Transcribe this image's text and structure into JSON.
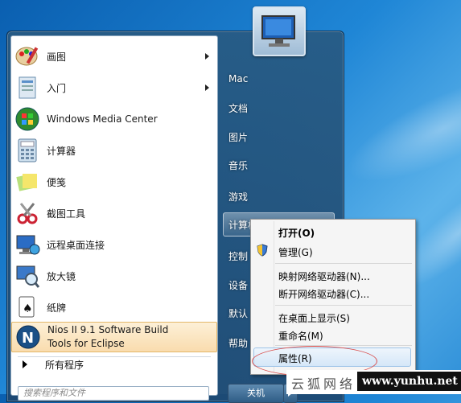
{
  "start_menu": {
    "programs": [
      {
        "label": "画图",
        "icon": "paint-icon",
        "submenu": true
      },
      {
        "label": "入门",
        "icon": "getting-started-icon",
        "submenu": true
      },
      {
        "label": "Windows Media Center",
        "icon": "media-center-icon",
        "submenu": false
      },
      {
        "label": "计算器",
        "icon": "calculator-icon",
        "submenu": false
      },
      {
        "label": "便笺",
        "icon": "sticky-notes-icon",
        "submenu": false
      },
      {
        "label": "截图工具",
        "icon": "snipping-tool-icon",
        "submenu": false
      },
      {
        "label": "远程桌面连接",
        "icon": "remote-desktop-icon",
        "submenu": false
      },
      {
        "label": "放大镜",
        "icon": "magnifier-icon",
        "submenu": false
      },
      {
        "label": "纸牌",
        "icon": "solitaire-icon",
        "submenu": false
      }
    ],
    "highlighted_program": {
      "line1": "Nios II  9.1 Software Build",
      "line2": "Tools for Eclipse",
      "icon": "nios-icon"
    },
    "all_programs": "所有程序",
    "search_placeholder": "搜索程序和文件",
    "right_items": [
      "Mac",
      "文档",
      "图片",
      "音乐",
      "游戏",
      "计算机",
      "控制",
      "设备",
      "默认",
      "帮助"
    ],
    "shutdown_label": "关机"
  },
  "context_menu": {
    "items": [
      "打开(O)",
      "管理(G)",
      "映射网络驱动器(N)...",
      "断开网络驱动器(C)...",
      "在桌面上显示(S)",
      "重命名(M)",
      "属性(R)"
    ]
  },
  "watermark": {
    "cn": "云狐网络",
    "url": "www.yunhu.net"
  },
  "colors": {
    "highlight": "#f9dcae",
    "ellipse": "#d9504f"
  }
}
